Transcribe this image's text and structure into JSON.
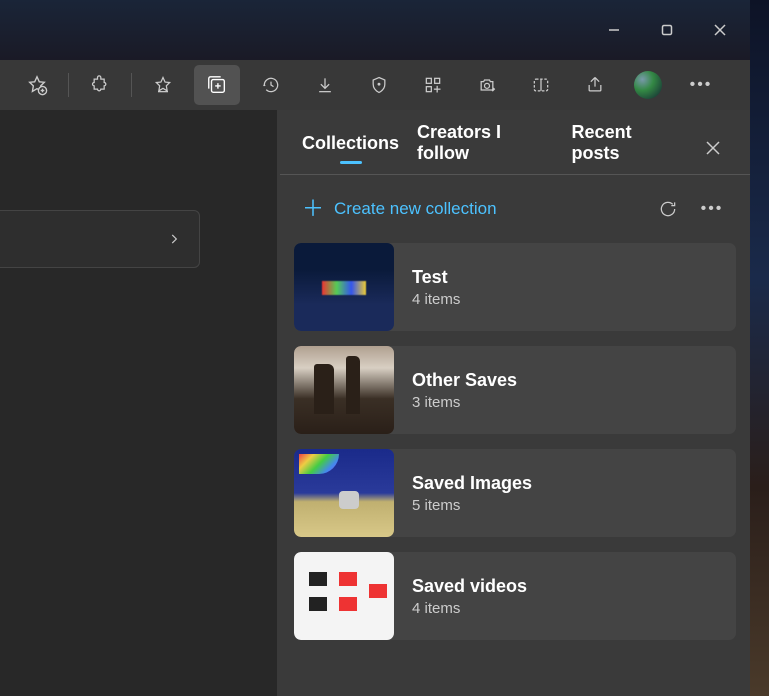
{
  "window": {
    "minimize": "−",
    "maximize": "▢",
    "close": "✕"
  },
  "toolbar": {
    "icons": [
      "add-favorite-icon",
      "extensions-icon",
      "favorites-star-icon",
      "collections-icon",
      "history-icon",
      "downloads-icon",
      "security-icon",
      "apps-icon",
      "screenshot-icon",
      "split-screen-icon",
      "share-icon",
      "profile-avatar",
      "more-icon"
    ]
  },
  "panel": {
    "tabs": {
      "collections": "Collections",
      "creators": "Creators I follow",
      "recent": "Recent posts"
    },
    "active_tab": "collections",
    "create_label": "Create new collection",
    "collections": [
      {
        "title": "Test",
        "subtitle": "4 items"
      },
      {
        "title": "Other Saves",
        "subtitle": "3 items"
      },
      {
        "title": "Saved Images",
        "subtitle": "5 items"
      },
      {
        "title": "Saved videos",
        "subtitle": "4 items"
      }
    ]
  }
}
